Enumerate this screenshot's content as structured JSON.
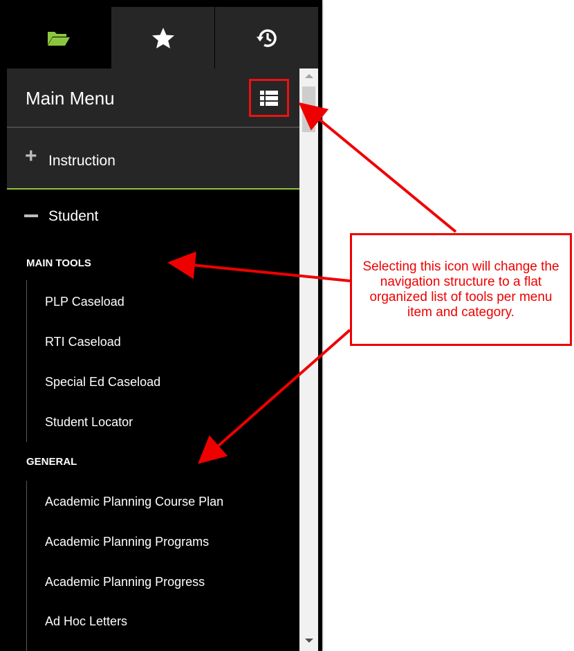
{
  "tabs": [
    {
      "icon": "folder-open-icon"
    },
    {
      "icon": "star-icon"
    },
    {
      "icon": "history-icon"
    }
  ],
  "menu": {
    "title": "Main Menu",
    "toggle_icon": "flat-list-icon"
  },
  "sections": {
    "instruction": {
      "label": "Instruction",
      "sign": "+"
    },
    "student": {
      "label": "Student"
    }
  },
  "categories": {
    "main_tools": {
      "label": "MAIN TOOLS",
      "items": [
        "PLP Caseload",
        "RTI Caseload",
        "Special Ed Caseload",
        "Student Locator"
      ]
    },
    "general": {
      "label": "GENERAL",
      "items": [
        "Academic Planning Course Plan",
        "Academic Planning Programs",
        "Academic Planning Progress",
        "Ad Hoc Letters"
      ]
    }
  },
  "callout": {
    "text": "Selecting this icon will change the navigation structure to a flat organized list of tools per menu item and category."
  },
  "colors": {
    "accent_green": "#8cc63f",
    "annotation_red": "#ee0000",
    "panel_dark": "#262626"
  }
}
